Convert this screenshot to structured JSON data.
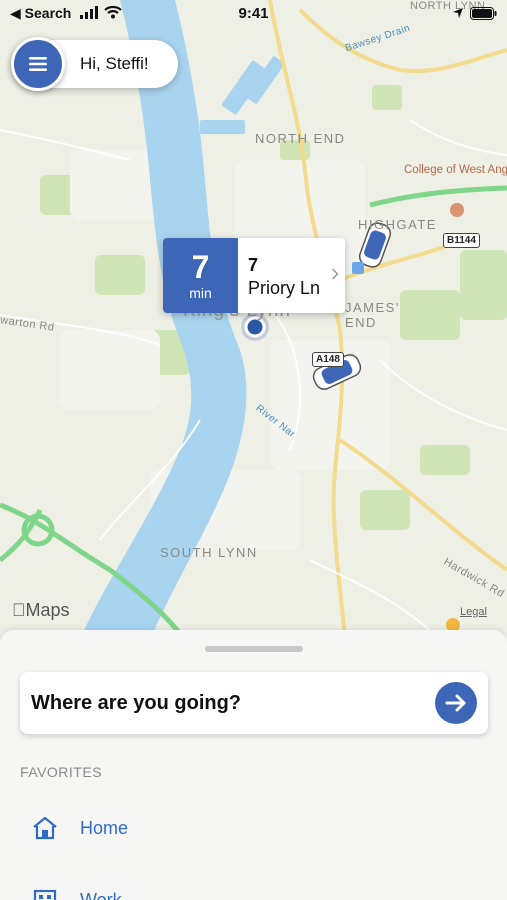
{
  "status_bar": {
    "back_label": "◀ Search",
    "time": "9:41"
  },
  "greeting": {
    "text": "Hi, Steffi!"
  },
  "eta": {
    "minutes": "7",
    "unit": "min",
    "number": "7",
    "street": "Priory Ln"
  },
  "map": {
    "labels": {
      "north_lynn": "NORTH LYNN",
      "bawsey_drain": "Bawsey Drain",
      "north_end": "NORTH END",
      "college": "College of West Anglia - King's Lynn Campus",
      "highgate": "HIGHGATE",
      "james_end": "JAMES' END",
      "kings_lynn": "King's Lynn",
      "warton_rd": "warton Rd",
      "river_nar": "River Nar",
      "south_lynn": "SOUTH LYNN",
      "hardwick_rd": "Hardwick Rd",
      "road_b1144": "B1144",
      "road_a148": "A148"
    },
    "attribution": "Maps",
    "legal": "Legal",
    "colors": {
      "water": "#a8d4ef",
      "land": "#eef0e6",
      "park": "#cfe5b6",
      "road_major": "#f3da8c",
      "road_green": "#7fd68a",
      "accent": "#3d66b6"
    }
  },
  "sheet": {
    "search_prompt": "Where are you going?",
    "favorites_heading": "FAVORITES",
    "favorites": [
      {
        "label": "Home",
        "icon": "home-icon"
      },
      {
        "label": "Work",
        "icon": "work-icon"
      }
    ]
  }
}
